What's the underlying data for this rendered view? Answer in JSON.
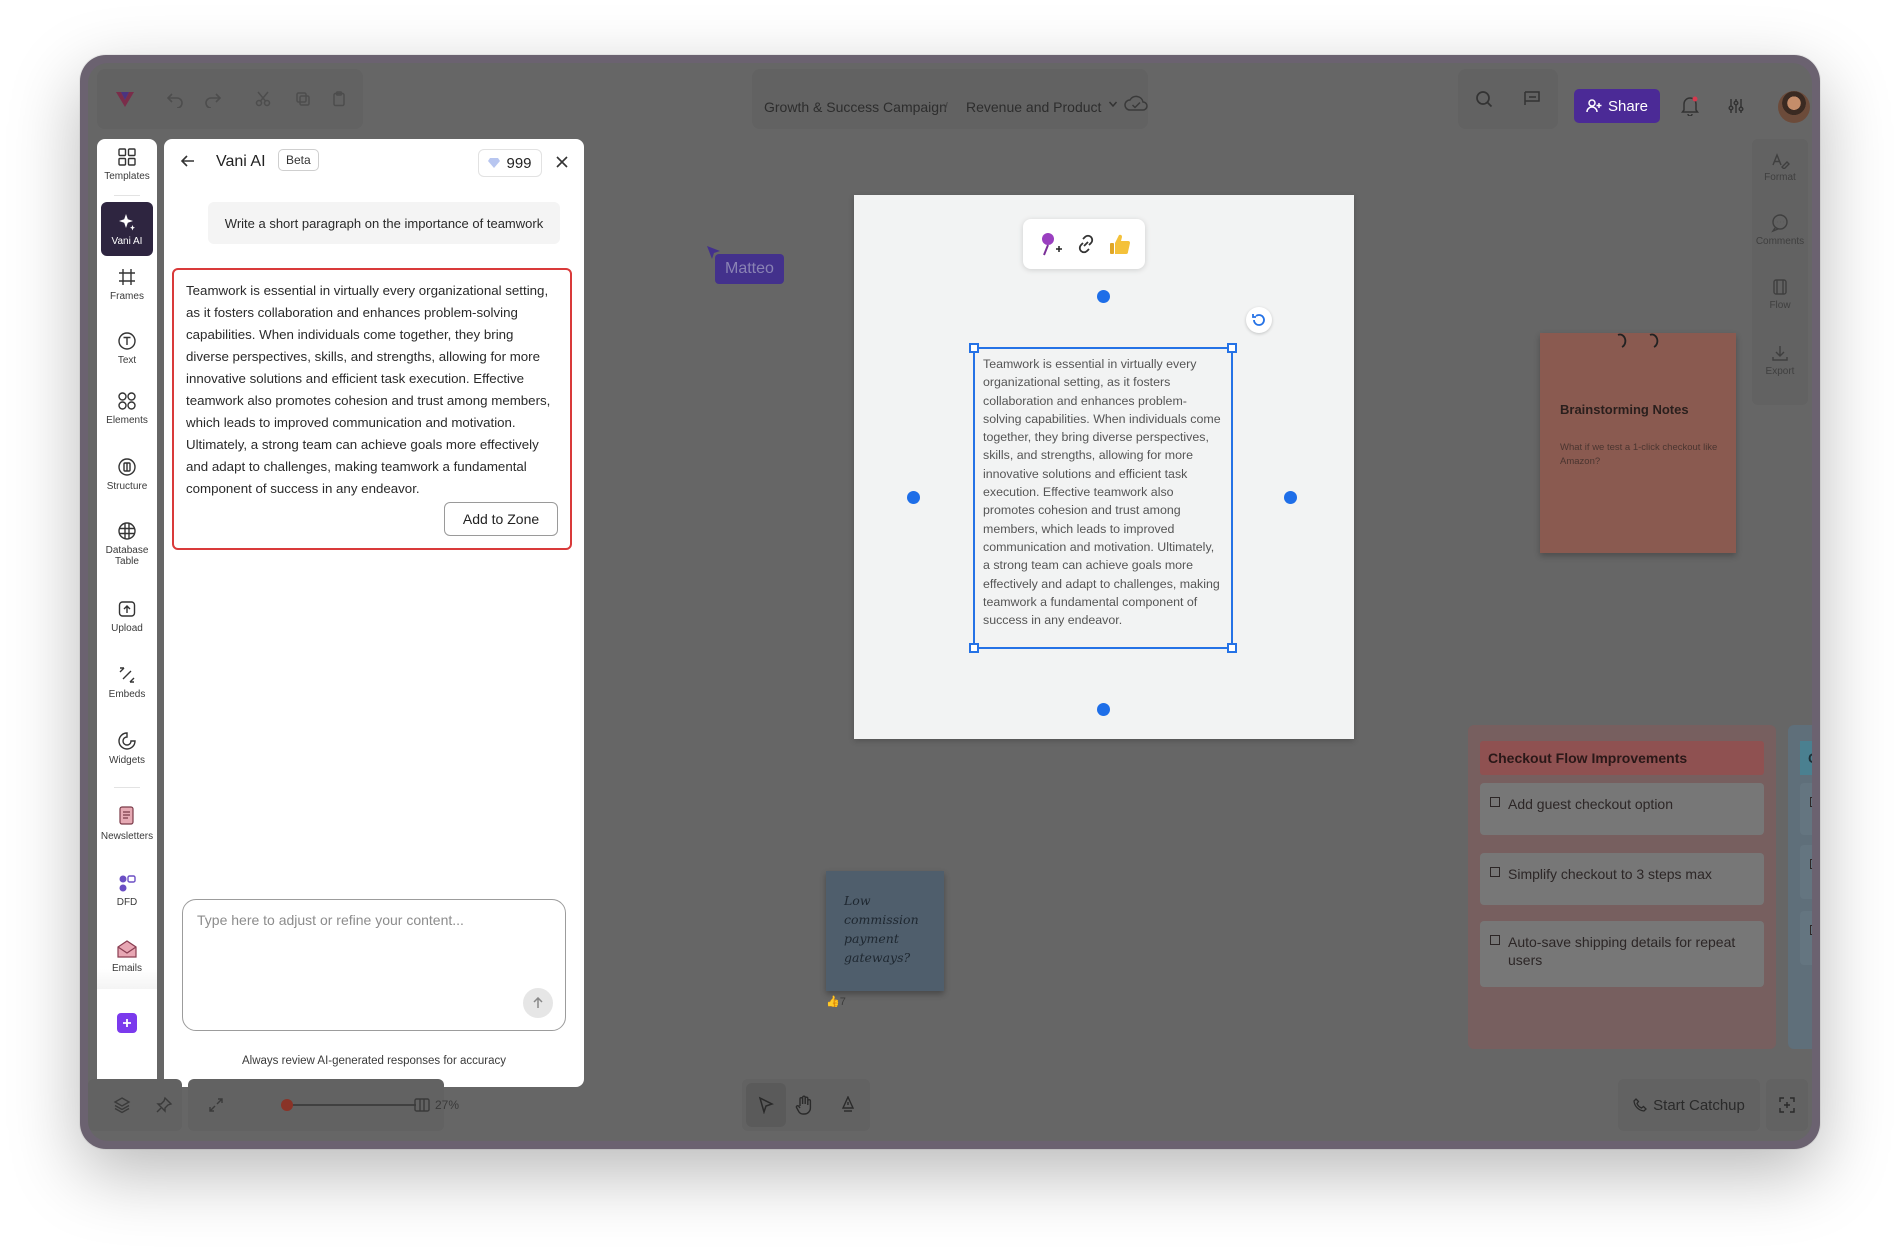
{
  "topbar": {
    "breadcrumb_parent": "Growth & Success Campaign",
    "breadcrumb_separator": "/",
    "breadcrumb_current": "Revenue and Product",
    "share_label": "Share"
  },
  "toolbar": {
    "items": [
      {
        "label": "Templates"
      },
      {
        "label": "Vani AI"
      },
      {
        "label": "Frames"
      },
      {
        "label": "Text"
      },
      {
        "label": "Elements"
      },
      {
        "label": "Structure"
      },
      {
        "label": "Database Table"
      },
      {
        "label": "Upload"
      },
      {
        "label": "Embeds"
      },
      {
        "label": "Widgets"
      },
      {
        "label": "Newsletters"
      },
      {
        "label": "DFD"
      },
      {
        "label": "Emails"
      }
    ]
  },
  "ai_panel": {
    "title": "Vani AI",
    "badge": "Beta",
    "credits": "999",
    "prompt": "Write a short paragraph on the importance of teamwork",
    "response": "Teamwork is essential in virtually every organizational setting, as it fosters collaboration and enhances problem-solving capabilities. When individuals come together, they bring diverse perspectives, skills, and strengths, allowing for more innovative solutions and efficient task execution. Effective teamwork also promotes cohesion and trust among members, which leads to improved communication and motivation. Ultimately, a strong team can achieve goals more effectively and adapt to challenges, making teamwork a fundamental component of success in any endeavor.",
    "add_button": "Add to Zone",
    "refine_placeholder": "Type here to adjust or refine your content...",
    "disclaimer": "Always review AI-generated responses for accuracy"
  },
  "canvas": {
    "cursor_user": "Matteo",
    "selected_text": "Teamwork is essential in virtually every organizational setting, as it fosters collaboration and enhances problem-solving capabilities. When individuals come together, they bring diverse perspectives, skills, and strengths, allowing for more innovative solutions and efficient task execution. Effective teamwork also promotes cohesion and trust among members, which leads to improved communication and motivation. Ultimately, a strong team can achieve goals more effectively and adapt to challenges, making teamwork a fundamental component of success in any endeavor.",
    "sticky_orange_title": "Brainstorming Notes",
    "sticky_orange_text": "What if we test a 1-click checkout like Amazon?",
    "sticky_blue_text": "Low commission payment gateways?",
    "sticky_blue_votes": "7",
    "kanban_title": "Checkout Flow Improvements",
    "kanban_items": [
      {
        "text": "Add guest checkout option"
      },
      {
        "text": "Simplify checkout to 3 steps max"
      },
      {
        "text": "Auto-save shipping details for repeat users"
      }
    ],
    "kanban2_title": "Cus"
  },
  "right_sidebar": {
    "items": [
      {
        "label": "Format"
      },
      {
        "label": "Comments"
      },
      {
        "label": "Flow"
      },
      {
        "label": "Export"
      }
    ]
  },
  "bottombar": {
    "zoom_level": "27%",
    "zoom_fraction": 0.0,
    "catchup_label": "Start Catchup"
  },
  "colors": {
    "brand": "#4b2a96",
    "selection": "#2572e6",
    "response_border": "#d93a3a"
  }
}
